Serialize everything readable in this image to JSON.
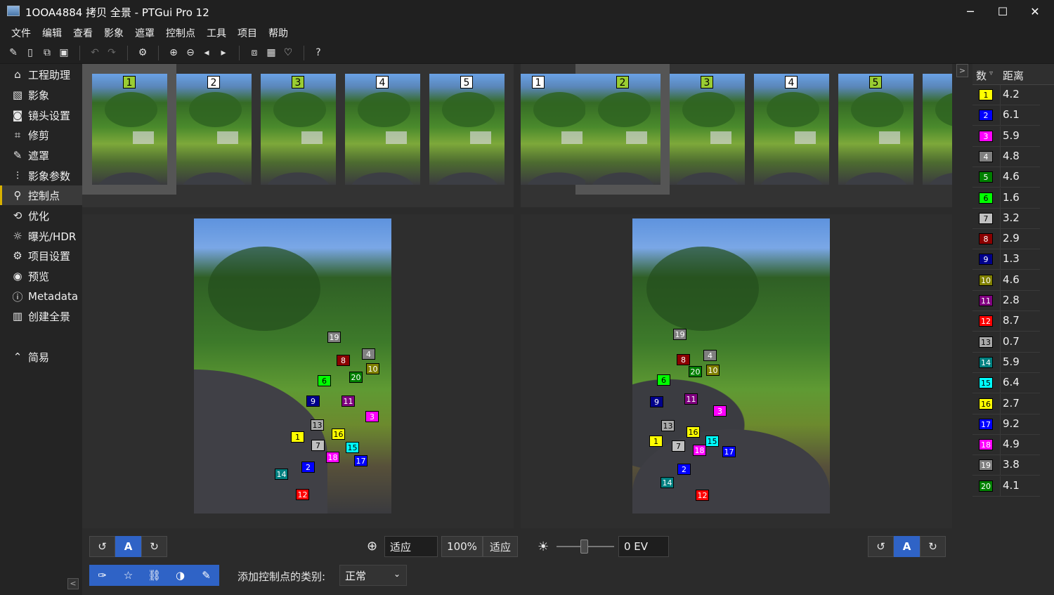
{
  "window": {
    "title": "1OOA4884 拷贝 全景 - PTGui Pro 12",
    "controls": {
      "minimize": "─",
      "maximize": "☐",
      "close": "✕"
    }
  },
  "menu": [
    "文件",
    "编辑",
    "查看",
    "影象",
    "遮罩",
    "控制点",
    "工具",
    "项目",
    "帮助"
  ],
  "toolbar_icons": [
    "new-project-icon",
    "open-icon",
    "duplicate-icon",
    "save-icon",
    "undo-icon",
    "redo-icon",
    "settings-icon",
    "zoom-in-icon",
    "zoom-out-icon",
    "previous-icon",
    "next-icon",
    "panorama-editor-icon",
    "table-icon",
    "hint-icon",
    "help-icon"
  ],
  "sidebar": {
    "items": [
      {
        "label": "工程助理",
        "icon": "home-icon",
        "glyph": "⌂"
      },
      {
        "label": "影象",
        "icon": "image-icon",
        "glyph": "▧"
      },
      {
        "label": "镜头设置",
        "icon": "camera-icon",
        "glyph": "◙"
      },
      {
        "label": "修剪",
        "icon": "crop-icon",
        "glyph": "⌗"
      },
      {
        "label": "遮罩",
        "icon": "mask-icon",
        "glyph": "✎"
      },
      {
        "label": "影象参数",
        "icon": "sliders-icon",
        "glyph": "⫶"
      },
      {
        "label": "控制点",
        "icon": "control-points-icon",
        "glyph": "⚲"
      },
      {
        "label": "优化",
        "icon": "optimize-icon",
        "glyph": "⟲"
      },
      {
        "label": "曝光/HDR",
        "icon": "exposure-icon",
        "glyph": "☼"
      },
      {
        "label": "项目设置",
        "icon": "gear-icon",
        "glyph": "⚙"
      },
      {
        "label": "预览",
        "icon": "eye-icon",
        "glyph": "◉"
      },
      {
        "label": "Metadata",
        "icon": "info-icon",
        "glyph": "ⓘ"
      },
      {
        "label": "创建全景",
        "icon": "panorama-icon",
        "glyph": "▥"
      }
    ],
    "simple": {
      "label": "简易",
      "icon": "simple-mode-icon",
      "glyph": "⌃"
    }
  },
  "left_strip": {
    "numbers": [
      "1",
      "2",
      "3",
      "4",
      "5"
    ],
    "selected": "1"
  },
  "right_strip": {
    "numbers": [
      "1",
      "2",
      "3",
      "4",
      "5"
    ],
    "selected": "2"
  },
  "control_points_left": [
    "19",
    "4",
    "8",
    "10",
    "6",
    "20",
    "9",
    "11",
    "3",
    "13",
    "16",
    "1",
    "7",
    "15",
    "18",
    "17",
    "2",
    "14",
    "12"
  ],
  "control_points_right": [
    "19",
    "8",
    "4",
    "20",
    "10",
    "6",
    "9",
    "11",
    "3",
    "13",
    "16",
    "15",
    "1",
    "7",
    "18",
    "17",
    "2",
    "14",
    "12"
  ],
  "cp_colors": {
    "1": "#ffff00",
    "2": "#0000ff",
    "3": "#ff00ff",
    "4": "#808080",
    "5": "#008000",
    "6": "#00ff00",
    "7": "#c0c0c0",
    "8": "#8b0000",
    "9": "#00008b",
    "10": "#808000",
    "11": "#800080",
    "12": "#ff0000",
    "13": "#a9a9a9",
    "14": "#008080",
    "15": "#00ffff",
    "16": "#ffff00",
    "17": "#0000ff",
    "18": "#ff00ff",
    "19": "#808080",
    "20": "#008000"
  },
  "cp_table": {
    "header": {
      "number": "数",
      "sort": "▿",
      "distance": "距离"
    },
    "rows": [
      {
        "n": "1",
        "d": "4.2"
      },
      {
        "n": "2",
        "d": "6.1"
      },
      {
        "n": "3",
        "d": "5.9"
      },
      {
        "n": "4",
        "d": "4.8"
      },
      {
        "n": "5",
        "d": "4.6"
      },
      {
        "n": "6",
        "d": "1.6"
      },
      {
        "n": "7",
        "d": "3.2"
      },
      {
        "n": "8",
        "d": "2.9"
      },
      {
        "n": "9",
        "d": "1.3"
      },
      {
        "n": "10",
        "d": "4.6"
      },
      {
        "n": "11",
        "d": "2.8"
      },
      {
        "n": "12",
        "d": "8.7"
      },
      {
        "n": "13",
        "d": "0.7"
      },
      {
        "n": "14",
        "d": "5.9"
      },
      {
        "n": "15",
        "d": "6.4"
      },
      {
        "n": "16",
        "d": "2.7"
      },
      {
        "n": "17",
        "d": "9.2"
      },
      {
        "n": "18",
        "d": "4.9"
      },
      {
        "n": "19",
        "d": "3.8"
      },
      {
        "n": "20",
        "d": "4.1"
      }
    ]
  },
  "bottom": {
    "auto_label": "A",
    "zoom_fit": "适应",
    "zoom_100": "100%",
    "zoom_fit2": "适应",
    "exposure": "0 EV",
    "cp_type_label": "添加控制点的类别:",
    "cp_type_value": "正常",
    "auto_label_right": "A"
  },
  "panel_toggle": ">",
  "collapse_toggle": "<"
}
